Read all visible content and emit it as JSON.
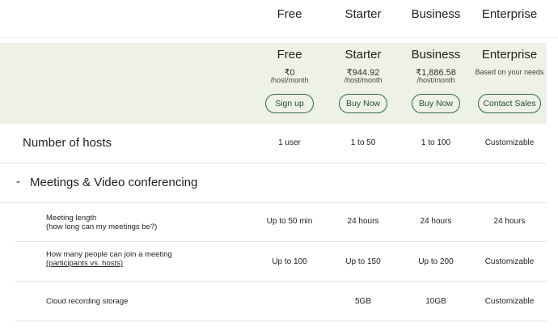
{
  "plans": [
    {
      "name": "Free",
      "price": "₹0",
      "unit": "/host/month",
      "note": "",
      "button": "Sign up"
    },
    {
      "name": "Starter",
      "price": "₹944.92",
      "unit": "/host/month",
      "note": "",
      "button": "Buy Now"
    },
    {
      "name": "Business",
      "price": "₹1,886.58",
      "unit": "/host/month",
      "note": "",
      "button": "Buy Now"
    },
    {
      "name": "Enterprise",
      "price": "",
      "unit": "",
      "note": "Based on your needs",
      "button": "Contact Sales"
    }
  ],
  "hosts": {
    "label": "Number of hosts",
    "values": [
      "1 user",
      "1 to 50",
      "1 to 100",
      "Customizable"
    ]
  },
  "section": {
    "toggle": "-",
    "title": "Meetings & Video conferencing"
  },
  "features": [
    {
      "line1": "Meeting length",
      "line2": "(how long can my meetings be?)",
      "values": [
        "Up to 50 min",
        "24 hours",
        "24 hours",
        "24 hours"
      ]
    },
    {
      "line1": "How many people can join a meeting",
      "line2": "(participants vs. hosts)",
      "values": [
        "Up to 100",
        "Up to 150",
        "Up to 200",
        "Customizable"
      ]
    },
    {
      "line1": "Cloud recording storage",
      "line2": "",
      "values": [
        "",
        "5GB",
        "10GB",
        "Customizable"
      ]
    }
  ]
}
